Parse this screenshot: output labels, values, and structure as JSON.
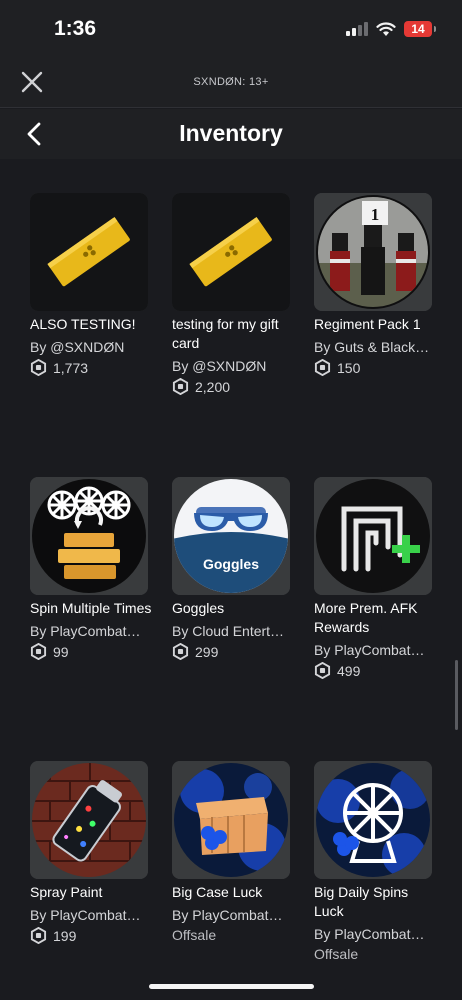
{
  "status": {
    "time": "1:36",
    "battery": "14"
  },
  "top_bar": {
    "account_label": "SXNDØN: 13+"
  },
  "header": {
    "title": "Inventory"
  },
  "items": [
    {
      "name": "ALSO TESTING!",
      "creator": "By @SXNDØN",
      "price": "1,773",
      "icon": "gift-card-icon"
    },
    {
      "name": "testing for my gift card",
      "creator": "By @SXNDØN",
      "price": "2,200",
      "icon": "gift-card-icon"
    },
    {
      "name": "Regiment Pack 1",
      "creator": "By Guts & Black…",
      "price": "150",
      "icon": "soldiers-icon"
    },
    {
      "name": "Spin Multiple Times",
      "creator": "By PlayCombat…",
      "price": "99",
      "icon": "spin-wheels-icon"
    },
    {
      "name": "Goggles",
      "creator": "By Cloud Entert…",
      "price": "299",
      "icon": "goggles-icon"
    },
    {
      "name": "More Prem. AFK Rewards",
      "creator": "By PlayCombat…",
      "price": "499",
      "icon": "afk-rewards-icon"
    },
    {
      "name": "Spray Paint",
      "creator": "By PlayCombat…",
      "price": "199",
      "icon": "spray-paint-icon"
    },
    {
      "name": "Big Case Luck",
      "creator": "By PlayCombat…",
      "offsale": "Offsale",
      "icon": "case-luck-icon"
    },
    {
      "name": "Big Daily Spins Luck",
      "creator": "By PlayCombat…",
      "offsale": "Offsale",
      "icon": "daily-spins-icon"
    }
  ],
  "colors": {
    "background": "#1a1b1f",
    "bar": "#1f2023",
    "tile": "#393b3d",
    "battery": "#e53935",
    "gold": "#e8b81a"
  },
  "thumb_text": {
    "goggles": "Goggles",
    "regiment": "1"
  }
}
